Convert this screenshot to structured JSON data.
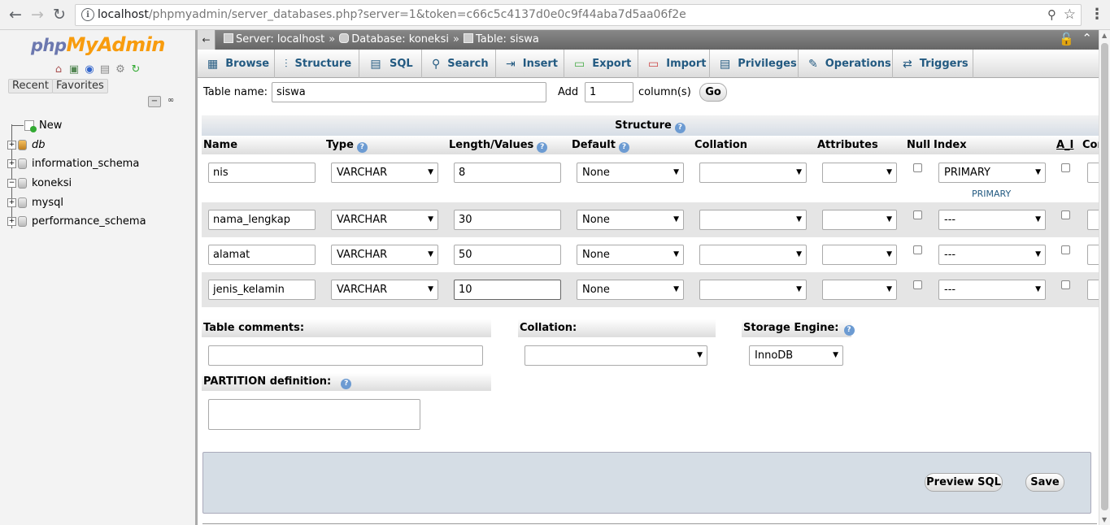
{
  "browser": {
    "url_host": "localhost",
    "url_rest": "/phpmyadmin/server_databases.php?server=1&token=c66c5c4137d0e0c9f44aba7d5aa06f2e"
  },
  "nav": {
    "logo": {
      "php": "php",
      "my": "My",
      "admin": "Admin"
    },
    "recent_label": "Recent",
    "favorites_label": "Favorites",
    "tree": [
      {
        "label": "New"
      },
      {
        "label": "db"
      },
      {
        "label": "information_schema"
      },
      {
        "label": "koneksi"
      },
      {
        "label": "mysql"
      },
      {
        "label": "performance_schema"
      }
    ]
  },
  "breadcrumb": {
    "back_label": "←",
    "server": "Server: localhost",
    "database": "Database: koneksi",
    "table": "Table: siswa",
    "separator": "»"
  },
  "tabs": [
    {
      "label": "Browse",
      "icon": "browse-icon"
    },
    {
      "label": "Structure",
      "icon": "structure-icon"
    },
    {
      "label": "SQL",
      "icon": "sql-icon"
    },
    {
      "label": "Search",
      "icon": "search-icon"
    },
    {
      "label": "Insert",
      "icon": "insert-icon"
    },
    {
      "label": "Export",
      "icon": "export-icon"
    },
    {
      "label": "Import",
      "icon": "import-icon"
    },
    {
      "label": "Privileges",
      "icon": "privileges-icon"
    },
    {
      "label": "Operations",
      "icon": "operations-icon"
    },
    {
      "label": "Triggers",
      "icon": "triggers-icon"
    }
  ],
  "form": {
    "table_name_label": "Table name:",
    "table_name_value": "siswa",
    "add_label": "Add",
    "add_value": "1",
    "columns_label": "column(s)",
    "go_label": "Go"
  },
  "structure": {
    "title": "Structure",
    "headers": {
      "name": "Name",
      "type": "Type",
      "length": "Length/Values",
      "default": "Default",
      "collation": "Collation",
      "attributes": "Attributes",
      "null": "Null",
      "index": "Index",
      "ai": "A_I",
      "comments": "Cor"
    },
    "rows": [
      {
        "name": "nis",
        "type": "VARCHAR",
        "length": "8",
        "default": "None",
        "collation": "",
        "attributes": "",
        "index": "PRIMARY",
        "index_note": "PRIMARY"
      },
      {
        "name": "nama_lengkap",
        "type": "VARCHAR",
        "length": "30",
        "default": "None",
        "collation": "",
        "attributes": "",
        "index": "---",
        "index_note": ""
      },
      {
        "name": "alamat",
        "type": "VARCHAR",
        "length": "50",
        "default": "None",
        "collation": "",
        "attributes": "",
        "index": "---",
        "index_note": ""
      },
      {
        "name": "jenis_kelamin",
        "type": "VARCHAR",
        "length": "10",
        "default": "None",
        "collation": "",
        "attributes": "",
        "index": "---",
        "index_note": ""
      }
    ]
  },
  "options": {
    "table_comments_label": "Table comments:",
    "table_comments_value": "",
    "collation_label": "Collation:",
    "collation_value": "",
    "storage_engine_label": "Storage Engine:",
    "storage_engine_value": "InnoDB",
    "partition_label": "PARTITION definition:",
    "partition_value": ""
  },
  "actions": {
    "preview_sql": "Preview SQL",
    "save": "Save"
  },
  "colors": {
    "tab_text": "#235a81",
    "logo_orange": "#f89c0e",
    "logo_blue": "#6c78af"
  }
}
